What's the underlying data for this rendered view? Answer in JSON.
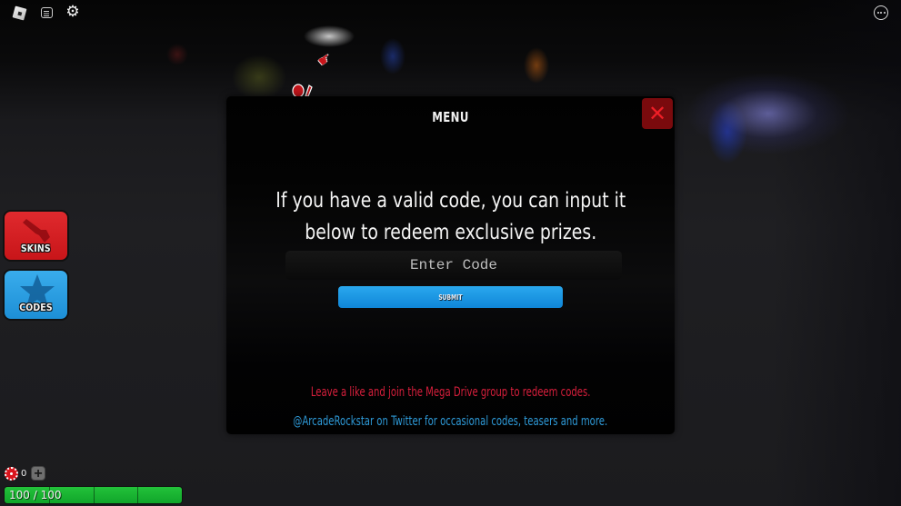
{
  "topbar": {
    "icons": [
      "roblox-logo-icon",
      "chat-icon",
      "gear-icon"
    ],
    "more_icon": "more-options-icon"
  },
  "side_buttons": [
    {
      "label": "SKINS",
      "icon": "gun-icon",
      "color": "#d81d21"
    },
    {
      "label": "CODES",
      "icon": "star-icon",
      "color": "#2a9fe4"
    }
  ],
  "hud": {
    "chip_count": "0",
    "add_label": "+",
    "health_text": "100 / 100",
    "health_fraction": 1.0,
    "health_segments": 4,
    "health_color": "#1fb534"
  },
  "modal": {
    "title": "MENU",
    "close_label": "✕",
    "intro_line1": "If you have a valid code, you can input it",
    "intro_line2": "below to redeem exclusive prizes.",
    "input_placeholder": "Enter Code",
    "input_value": "",
    "submit_label": "SUBMIT",
    "notice_red": "Leave a like and join the Mega Drive group to redeem codes.",
    "notice_blue": "@ArcadeRockstar on Twitter for occasional codes, teasers and more.",
    "accent_red": "#d81f3c",
    "accent_blue": "#2e9ad8"
  }
}
